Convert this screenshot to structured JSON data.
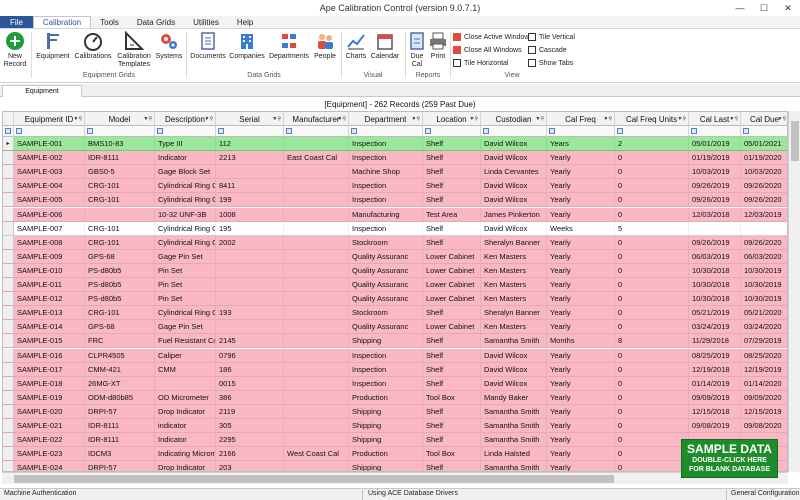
{
  "window": {
    "title": "Ape Calibration Control (version 9.0.7.1)",
    "minimize": "—",
    "maximize": "☐",
    "close": "✕"
  },
  "menu": [
    "File",
    "Calibration",
    "Tools",
    "Data Grids",
    "Utilities",
    "Help"
  ],
  "ribbon": {
    "new_record": "New Record",
    "equipment": "Equipment",
    "calibrations": "Calibrations",
    "calibration_templates": "Calibration Templates",
    "systems": "Systems",
    "documents": "Documents",
    "companies": "Companies",
    "departments": "Departments",
    "people": "People",
    "charts": "Charts",
    "calendar": "Calendar",
    "due_cal": "Due Cal",
    "print": "Print",
    "close_active_window": "Close Active Window",
    "close_all_windows": "Close All Windows",
    "tile_horizontal": "Tile Horizontal",
    "tile_vertical": "Tile Vertical",
    "cascade": "Cascade",
    "show_tabs": "Show Tabs",
    "groups": {
      "equipment_grids": "Equipment Grids",
      "data_grids": "Data Grids",
      "visual": "Visual",
      "reports": "Reports",
      "view": "View"
    }
  },
  "tab": "Equipment",
  "grid": {
    "title": "[Equipment] - 262 Records (259 Past Due)",
    "columns": [
      "Equipment ID",
      "Model",
      "Description",
      "Serial",
      "Manufacturer",
      "Department",
      "Location",
      "Custodian",
      "Cal Freq",
      "Cal Freq Units",
      "Cal Last",
      "Cal Due"
    ],
    "rows": [
      [
        "SAMPLE-001",
        "BMS10-83",
        "Type III",
        "112",
        "",
        "Inspection",
        "Shelf",
        "David Wilcox",
        "Years",
        "2",
        "05/01/2019",
        "05/01/2021"
      ],
      [
        "SAMPLE-002",
        "IDR-8111",
        "Indicator",
        "2213",
        "East Coast Cal",
        "Inspection",
        "Shelf",
        "David Wilcox",
        "Yearly",
        "0",
        "01/19/2019",
        "01/19/2020"
      ],
      [
        "SAMPLE-003",
        "GBS0-5",
        "Gage Block Set",
        "",
        "",
        "Machine Shop",
        "Shelf",
        "Linda Cervantes",
        "Yearly",
        "0",
        "10/03/2019",
        "10/03/2020"
      ],
      [
        "SAMPLE-004",
        "CRG-101",
        "Cylindrical Ring G",
        "8411",
        "",
        "Inspection",
        "Shelf",
        "David Wilcox",
        "Yearly",
        "0",
        "09/26/2019",
        "09/26/2020"
      ],
      [
        "SAMPLE-005",
        "CRG-101",
        "Cylindrical Ring G",
        "199",
        "",
        "Inspection",
        "Shelf",
        "David Wilcox",
        "Yearly",
        "0",
        "09/26/2019",
        "09/26/2020"
      ],
      [
        "SAMPLE-006",
        "",
        "10-32 UNF-3B",
        "1008",
        "",
        "Manufacturing",
        "Test Area",
        "James Pinkerton",
        "Yearly",
        "0",
        "12/03/2018",
        "12/03/2019"
      ],
      [
        "SAMPLE-007",
        "CRG-101",
        "Cylindrical Ring G",
        "195",
        "",
        "Inspection",
        "Shelf",
        "David Wilcox",
        "Weeks",
        "5",
        "",
        ""
      ],
      [
        "SAMPLE-008",
        "CRG-101",
        "Cylindrical Ring G",
        "2002",
        "",
        "Stockroom",
        "Shelf",
        "Sheralyn Banner",
        "Yearly",
        "0",
        "09/26/2019",
        "09/26/2020"
      ],
      [
        "SAMPLE-009",
        "GPS-68",
        "Gage Pin Set",
        "",
        "",
        "Quality Assuranc",
        "Lower Cabinet",
        "Ken Masters",
        "Yearly",
        "0",
        "06/03/2019",
        "06/03/2020"
      ],
      [
        "SAMPLE-010",
        "PS-d80b5",
        "Pin Set",
        "",
        "",
        "Quality Assuranc",
        "Lower Cabinet",
        "Ken Masters",
        "Yearly",
        "0",
        "10/30/2018",
        "10/30/2019"
      ],
      [
        "SAMPLE-011",
        "PS-d80b5",
        "Pin Set",
        "",
        "",
        "Quality Assuranc",
        "Lower Cabinet",
        "Ken Masters",
        "Yearly",
        "0",
        "10/30/2018",
        "10/30/2019"
      ],
      [
        "SAMPLE-012",
        "PS-d80b5",
        "Pin Set",
        "",
        "",
        "Quality Assuranc",
        "Lower Cabinet",
        "Ken Masters",
        "Yearly",
        "0",
        "10/30/2018",
        "10/30/2019"
      ],
      [
        "SAMPLE-013",
        "CRG-101",
        "Cylindrical Ring G",
        "193",
        "",
        "Stockroom",
        "Shelf",
        "Sheralyn Banner",
        "Yearly",
        "0",
        "05/21/2019",
        "05/21/2020"
      ],
      [
        "SAMPLE-014",
        "GPS-68",
        "Gage Pin Set",
        "",
        "",
        "Quality Assuranc",
        "Lower Cabinet",
        "Ken Masters",
        "Yearly",
        "0",
        "03/24/2019",
        "03/24/2020"
      ],
      [
        "SAMPLE-015",
        "FRC",
        "Fuel Resistant Co",
        "2145",
        "",
        "Shipping",
        "Shelf",
        "Samantha Smith",
        "Months",
        "8",
        "11/29/2018",
        "07/29/2019"
      ],
      [
        "SAMPLE-016",
        "CLPR4505",
        "Caliper",
        "0796",
        "",
        "Inspection",
        "Shelf",
        "David Wilcox",
        "Yearly",
        "0",
        "08/25/2019",
        "08/25/2020"
      ],
      [
        "SAMPLE-017",
        "CMM-421",
        "CMM",
        "186",
        "",
        "Inspection",
        "Shelf",
        "David Wilcox",
        "Yearly",
        "0",
        "12/19/2018",
        "12/19/2019"
      ],
      [
        "SAMPLE-018",
        "26MG-XT",
        "",
        "0015",
        "",
        "Inspection",
        "Shelf",
        "David Wilcox",
        "Yearly",
        "0",
        "01/14/2019",
        "01/14/2020"
      ],
      [
        "SAMPLE-019",
        "ODM-d80b85",
        "OD Micrometer",
        "386",
        "",
        "Production",
        "Tool Box",
        "Mandy Baker",
        "Yearly",
        "0",
        "09/09/2019",
        "09/09/2020"
      ],
      [
        "SAMPLE-020",
        "DRPI-57",
        "Drop Indicator",
        "2119",
        "",
        "Shipping",
        "Shelf",
        "Samantha Smith",
        "Yearly",
        "0",
        "12/15/2018",
        "12/15/2019"
      ],
      [
        "SAMPLE-021",
        "IDR-8111",
        "indicator",
        "305",
        "",
        "Shipping",
        "Shelf",
        "Samantha Smith",
        "Yearly",
        "0",
        "09/08/2019",
        "09/08/2020"
      ],
      [
        "SAMPLE-022",
        "IDR-8111",
        "Indicator",
        "2295",
        "",
        "Shipping",
        "Shelf",
        "Samantha Smith",
        "Yearly",
        "0",
        "",
        ""
      ],
      [
        "SAMPLE-023",
        "IDCM3",
        "Indicating Microm",
        "2166",
        "West Coast Cal",
        "Production",
        "Tool Box",
        "Linda Halsted",
        "Yearly",
        "0",
        "",
        ""
      ],
      [
        "SAMPLE-024",
        "DRPI-57",
        "Drop Indicator",
        "203",
        "",
        "Shipping",
        "Shelf",
        "Samantha Smith",
        "Yearly",
        "0",
        "",
        ""
      ]
    ],
    "row_colors": {
      "green": "#9be79b",
      "pink": "#f9b8c4",
      "white": "#ffffff"
    }
  },
  "sample_badge": {
    "title": "SAMPLE DATA",
    "line1": "DOUBLE-CLICK HERE",
    "line2": "FOR BLANK DATABASE"
  },
  "status": {
    "left": "Machine Authentication",
    "middle": "Using ACE Database Drivers",
    "right": "General Configuration"
  },
  "accent": "#2b579a"
}
